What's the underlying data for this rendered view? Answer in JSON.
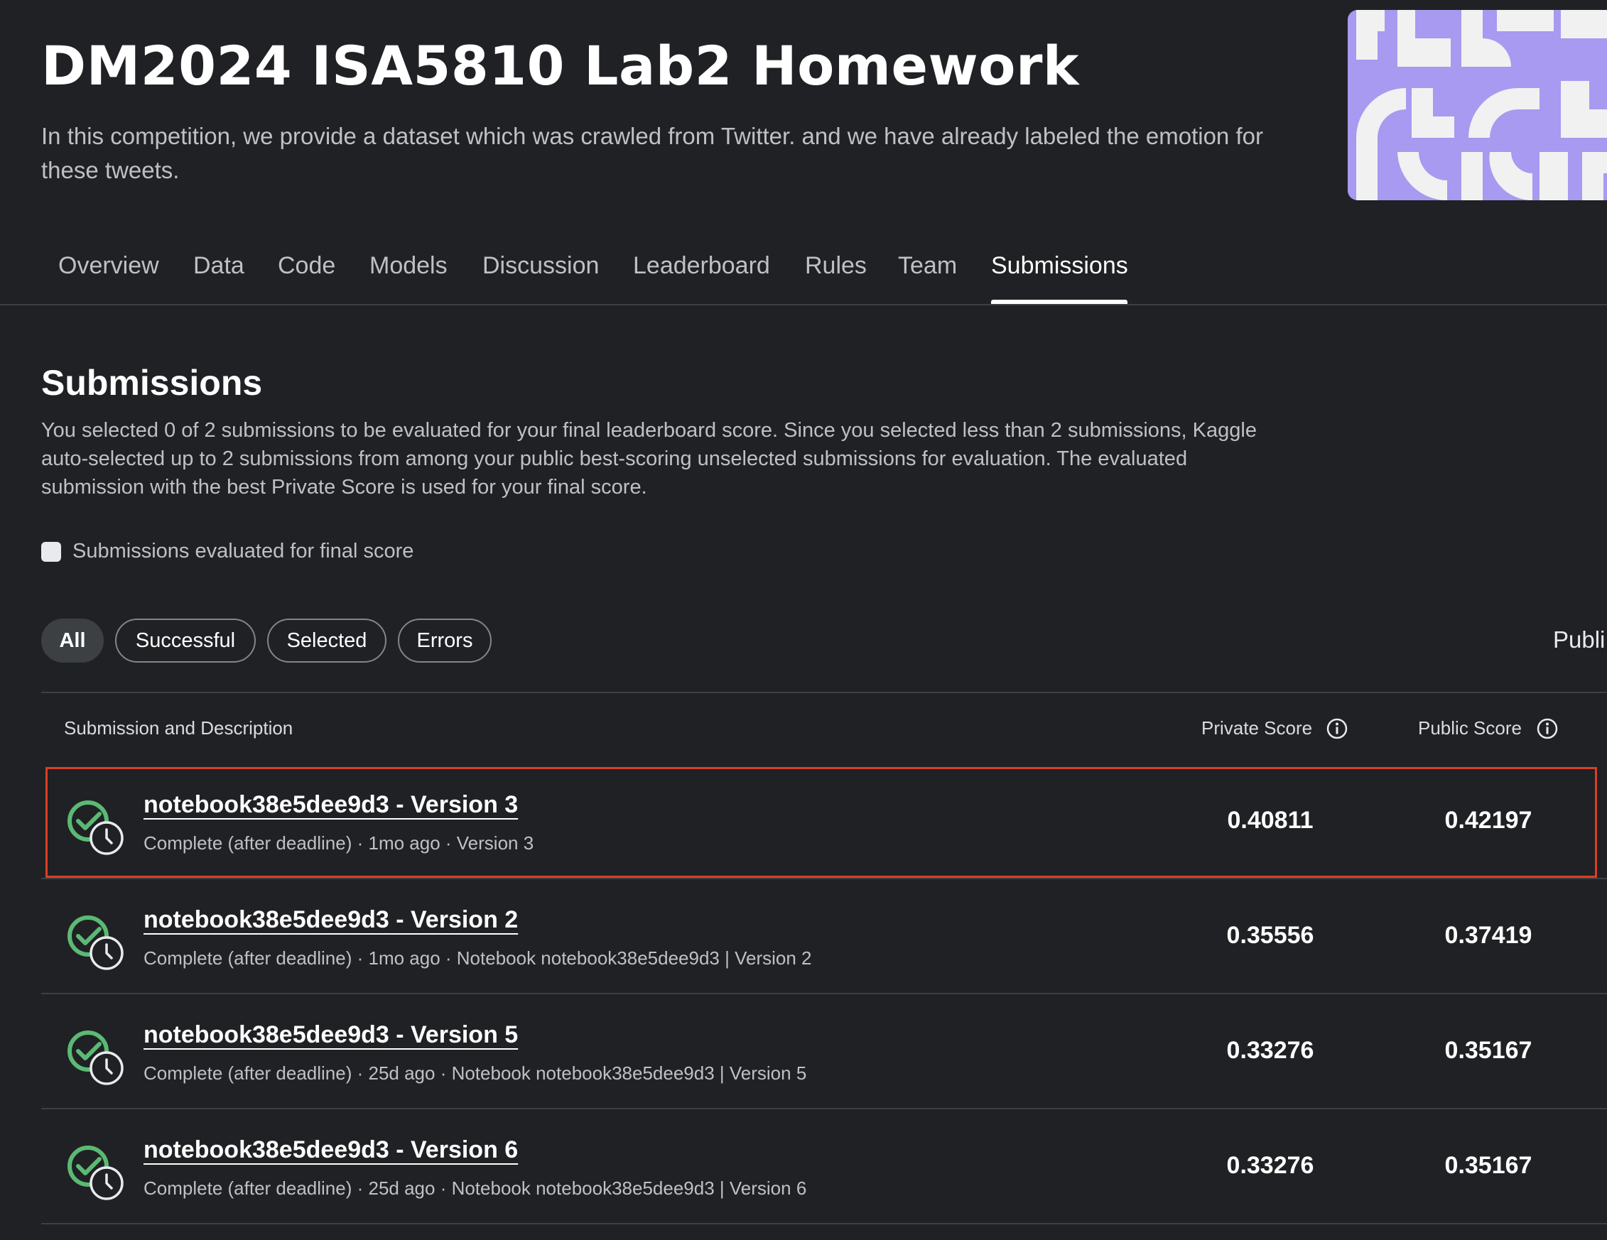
{
  "competition": {
    "title": "DM2024 ISA5810 Lab2 Homework",
    "description": "In this competition, we provide a dataset which was crawled from Twitter. and we have already labeled the emotion for these tweets."
  },
  "tabs": [
    {
      "label": "Overview"
    },
    {
      "label": "Data"
    },
    {
      "label": "Code"
    },
    {
      "label": "Models"
    },
    {
      "label": "Discussion"
    },
    {
      "label": "Leaderboard"
    },
    {
      "label": "Rules"
    },
    {
      "label": "Team"
    },
    {
      "label": "Submissions",
      "active": true
    }
  ],
  "submissions_section": {
    "title": "Submissions",
    "description": "You selected 0 of 2 submissions to be evaluated for your final leaderboard score. Since you selected less than 2 submissions, Kaggle auto-selected up to 2 submissions from among your public best-scoring unselected submissions for evaluation. The evaluated submission with the best Private Score is used for your final score.",
    "legend_label": "Submissions evaluated for final score"
  },
  "filters": [
    {
      "label": "All",
      "active": true
    },
    {
      "label": "Successful"
    },
    {
      "label": "Selected"
    },
    {
      "label": "Errors"
    }
  ],
  "sort_label": "Publi",
  "table": {
    "headers": {
      "submission": "Submission and Description",
      "private_score": "Private Score",
      "public_score": "Public Score"
    },
    "rows": [
      {
        "title": "notebook38e5dee9d3 - Version 3",
        "meta": "Complete (after deadline) · 1mo ago · Version 3",
        "private_score": "0.40811",
        "public_score": "0.42197",
        "highlighted": true
      },
      {
        "title": "notebook38e5dee9d3 - Version 2",
        "meta": "Complete (after deadline) · 1mo ago · Notebook notebook38e5dee9d3 | Version 2",
        "private_score": "0.35556",
        "public_score": "0.37419"
      },
      {
        "title": "notebook38e5dee9d3 - Version 5",
        "meta": "Complete (after deadline) · 25d ago · Notebook notebook38e5dee9d3 | Version 5",
        "private_score": "0.33276",
        "public_score": "0.35167"
      },
      {
        "title": "notebook38e5dee9d3 - Version 6",
        "meta": "Complete (after deadline) · 25d ago · Notebook notebook38e5dee9d3 | Version 6",
        "private_score": "0.33276",
        "public_score": "0.35167"
      }
    ]
  },
  "colors": {
    "background": "#202124",
    "banner": "#a79af0",
    "success": "#5bb974",
    "highlight_border": "#d93f26"
  },
  "icons": [
    "info-icon",
    "check-circle-icon",
    "clock-icon",
    "competition-banner-pattern"
  ]
}
